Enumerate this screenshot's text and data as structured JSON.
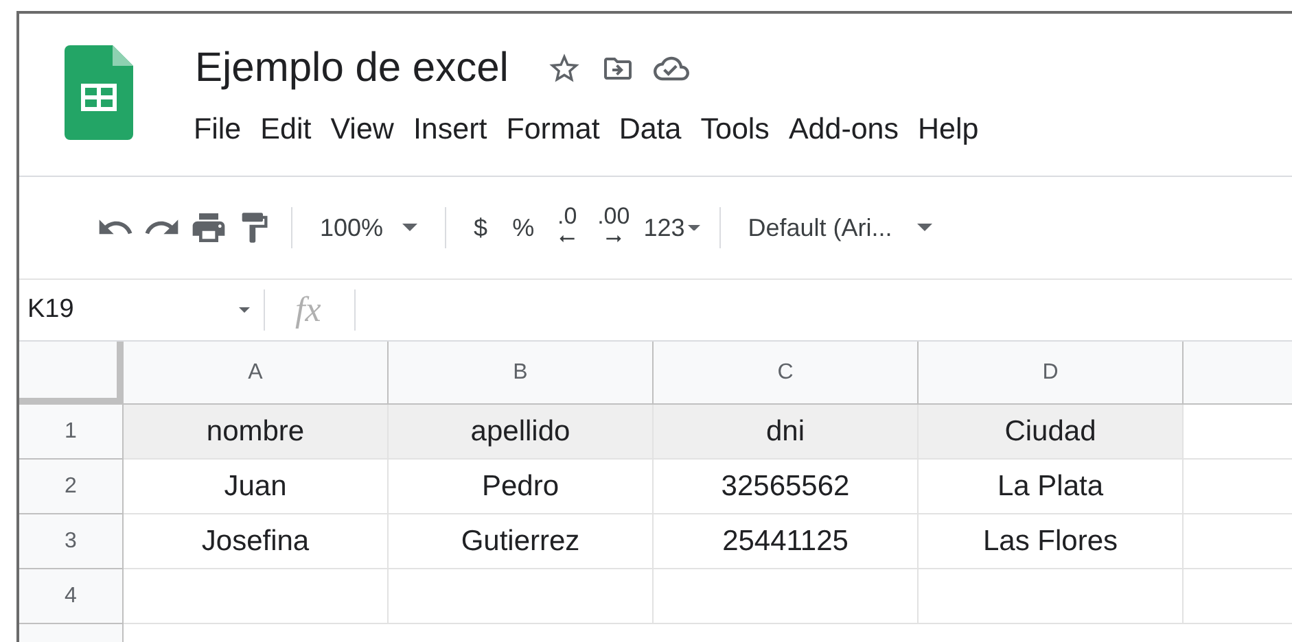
{
  "document": {
    "title": "Ejemplo de excel"
  },
  "menu": [
    "File",
    "Edit",
    "View",
    "Insert",
    "Format",
    "Data",
    "Tools",
    "Add-ons",
    "Help"
  ],
  "toolbar": {
    "zoom": "100%",
    "currency": "$",
    "percent": "%",
    "decrease_decimal": ".0",
    "increase_decimal": ".00",
    "number_format": "123",
    "font": "Default (Ari..."
  },
  "formula_bar": {
    "name_box": "K19",
    "fx_label": "fx"
  },
  "sheet": {
    "columns": [
      "A",
      "B",
      "C",
      "D"
    ],
    "rows": [
      {
        "number": "1",
        "shaded": true,
        "cells": [
          "nombre",
          "apellido",
          "dni",
          "Ciudad"
        ]
      },
      {
        "number": "2",
        "shaded": false,
        "cells": [
          "Juan",
          "Pedro",
          "32565562",
          "La Plata"
        ]
      },
      {
        "number": "3",
        "shaded": false,
        "cells": [
          "Josefina",
          "Gutierrez",
          "25441125",
          "Las Flores"
        ]
      },
      {
        "number": "4",
        "shaded": false,
        "cells": []
      }
    ]
  }
}
